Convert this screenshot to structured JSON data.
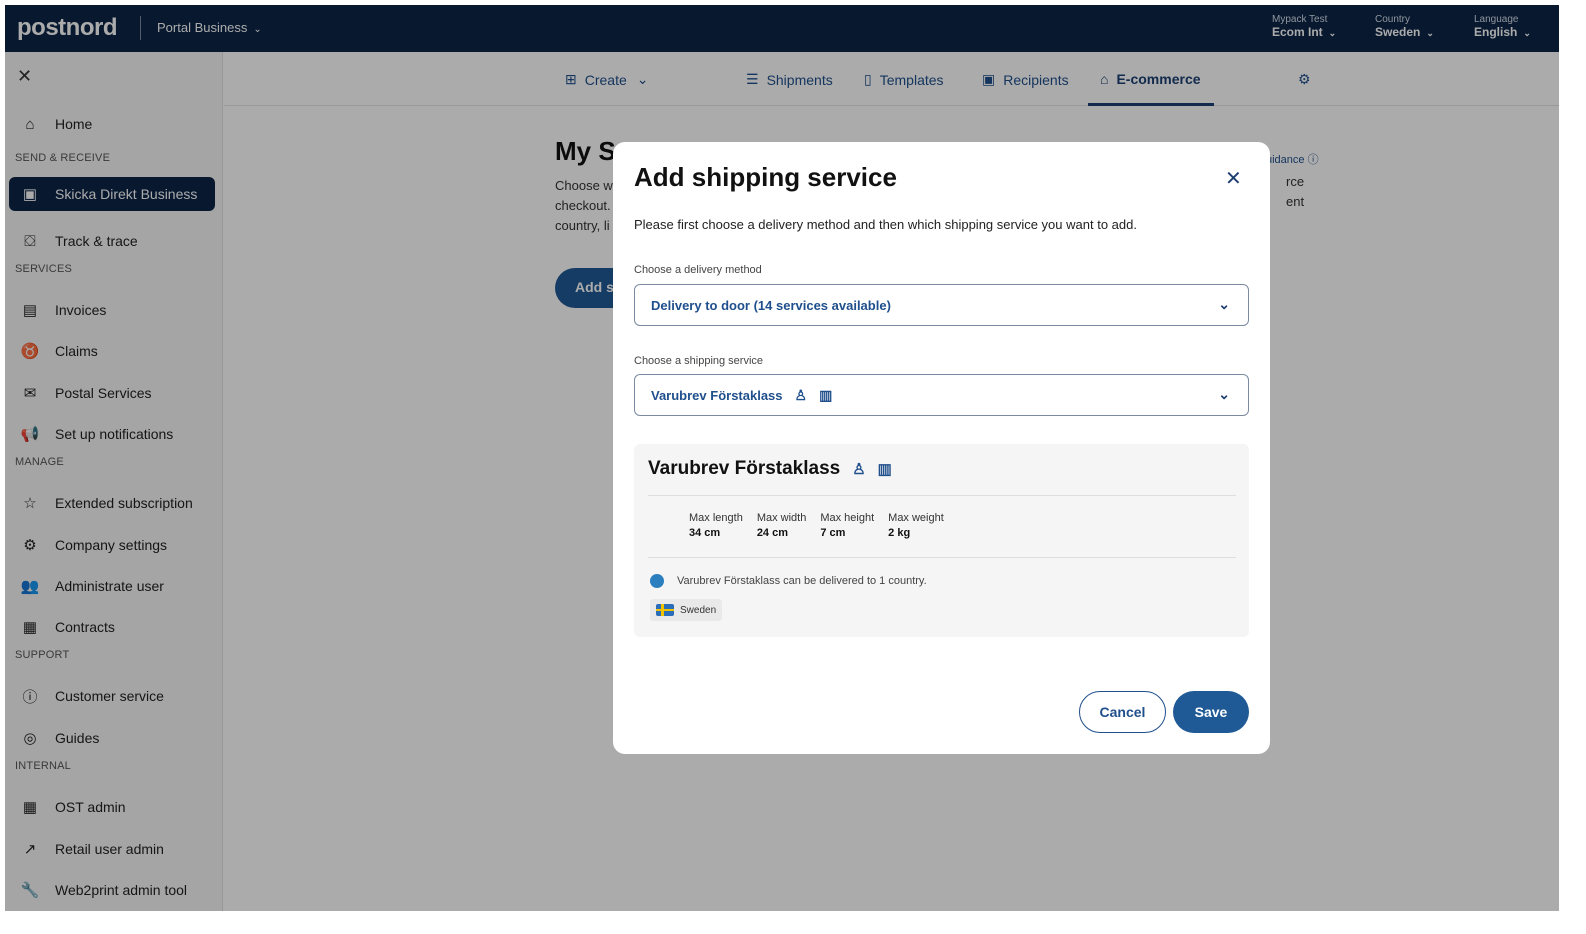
{
  "topbar": {
    "logo": "postnord",
    "portal": "Portal Business",
    "account": {
      "label": "Mypack Test",
      "value": "Ecom Int"
    },
    "country": {
      "label": "Country",
      "value": "Sweden"
    },
    "language": {
      "label": "Language",
      "value": "English"
    }
  },
  "sidebar": {
    "close": "✕",
    "items": [
      {
        "label": "Home",
        "icon": "home-icon"
      },
      {
        "label": "Skicka Direkt Business",
        "icon": "box-icon"
      },
      {
        "label": "Track & trace",
        "icon": "package-icon"
      },
      {
        "label": "Invoices",
        "icon": "money-icon"
      },
      {
        "label": "Claims",
        "icon": "trophy-icon"
      },
      {
        "label": "Postal Services",
        "icon": "mail-icon"
      },
      {
        "label": "Set up notifications",
        "icon": "megaphone-icon"
      },
      {
        "label": "Extended subscription",
        "icon": "star-icon"
      },
      {
        "label": "Company settings",
        "icon": "gear-icon"
      },
      {
        "label": "Administrate user",
        "icon": "users-icon"
      },
      {
        "label": "Contracts",
        "icon": "contract-icon"
      },
      {
        "label": "Customer service",
        "icon": "help-icon"
      },
      {
        "label": "Guides",
        "icon": "compass-icon"
      },
      {
        "label": "OST admin",
        "icon": "contract-icon"
      },
      {
        "label": "Retail user admin",
        "icon": "external-link-icon"
      },
      {
        "label": "Web2print admin tool",
        "icon": "wrench-icon"
      }
    ],
    "sections": [
      "SEND & RECEIVE",
      "SERVICES",
      "MANAGE",
      "SUPPORT",
      "INTERNAL"
    ]
  },
  "tabs": {
    "create": "Create",
    "shipments": "Shipments",
    "templates": "Templates",
    "recipients": "Recipients",
    "ecommerce": "E-commerce"
  },
  "page": {
    "title": "My S",
    "desc1": "Choose w",
    "desc2": "checkout.",
    "desc3": "country, li",
    "button": "Add s",
    "guidance": "uidance",
    "right1": "rce",
    "right2": "ent"
  },
  "modal": {
    "title": "Add shipping service",
    "intro": "Please first choose a delivery method and then which shipping service you want to add.",
    "delivery_label": "Choose a delivery method",
    "delivery_value": "Delivery to door (14 services available)",
    "service_label": "Choose a shipping service",
    "service_value": "Varubrev Förstaklass",
    "card_title": "Varubrev Förstaklass",
    "dims": [
      {
        "label": "Max length",
        "value": "34 cm"
      },
      {
        "label": "Max width",
        "value": "24 cm"
      },
      {
        "label": "Max height",
        "value": "7 cm"
      },
      {
        "label": "Max weight",
        "value": "2 kg"
      }
    ],
    "delivery_note": "Varubrev Förstaklass can be delivered to 1 country.",
    "country_chip": "Sweden",
    "cancel": "Cancel",
    "save": "Save"
  }
}
